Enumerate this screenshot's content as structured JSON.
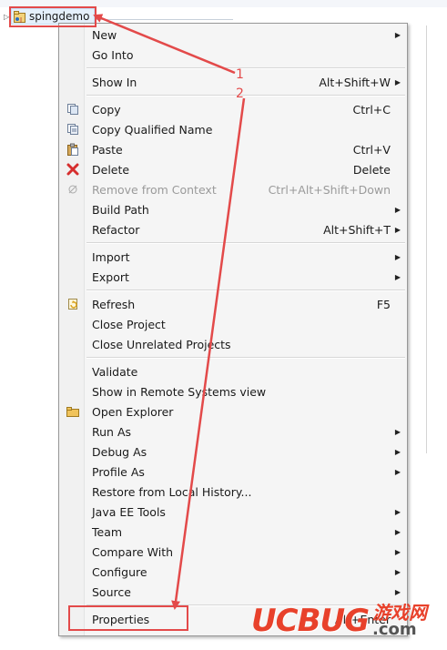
{
  "tree": {
    "project_name": "spingdemo"
  },
  "menu": {
    "groups": [
      [
        {
          "label": "New",
          "shortcut": "",
          "submenu": true,
          "disabled": false,
          "icon": ""
        },
        {
          "label": "Go Into",
          "shortcut": "",
          "submenu": false,
          "disabled": false,
          "icon": ""
        }
      ],
      [
        {
          "label": "Show In",
          "shortcut": "Alt+Shift+W",
          "submenu": true,
          "disabled": false,
          "icon": ""
        }
      ],
      [
        {
          "label": "Copy",
          "shortcut": "Ctrl+C",
          "submenu": false,
          "disabled": false,
          "icon": "copy-icon"
        },
        {
          "label": "Copy Qualified Name",
          "shortcut": "",
          "submenu": false,
          "disabled": false,
          "icon": "copy-qualified-name-icon"
        },
        {
          "label": "Paste",
          "shortcut": "Ctrl+V",
          "submenu": false,
          "disabled": false,
          "icon": "paste-icon"
        },
        {
          "label": "Delete",
          "shortcut": "Delete",
          "submenu": false,
          "disabled": false,
          "icon": "delete-icon"
        },
        {
          "label": "Remove from Context",
          "shortcut": "Ctrl+Alt+Shift+Down",
          "submenu": false,
          "disabled": true,
          "icon": "remove-from-context-icon"
        },
        {
          "label": "Build Path",
          "shortcut": "",
          "submenu": true,
          "disabled": false,
          "icon": ""
        },
        {
          "label": "Refactor",
          "shortcut": "Alt+Shift+T",
          "submenu": true,
          "disabled": false,
          "icon": ""
        }
      ],
      [
        {
          "label": "Import",
          "shortcut": "",
          "submenu": true,
          "disabled": false,
          "icon": ""
        },
        {
          "label": "Export",
          "shortcut": "",
          "submenu": true,
          "disabled": false,
          "icon": ""
        }
      ],
      [
        {
          "label": "Refresh",
          "shortcut": "F5",
          "submenu": false,
          "disabled": false,
          "icon": "refresh-icon"
        },
        {
          "label": "Close Project",
          "shortcut": "",
          "submenu": false,
          "disabled": false,
          "icon": ""
        },
        {
          "label": "Close Unrelated Projects",
          "shortcut": "",
          "submenu": false,
          "disabled": false,
          "icon": ""
        }
      ],
      [
        {
          "label": "Validate",
          "shortcut": "",
          "submenu": false,
          "disabled": false,
          "icon": ""
        },
        {
          "label": "Show in Remote Systems view",
          "shortcut": "",
          "submenu": false,
          "disabled": false,
          "icon": ""
        },
        {
          "label": "Open Explorer",
          "shortcut": "",
          "submenu": false,
          "disabled": false,
          "icon": "folder-icon"
        },
        {
          "label": "Run As",
          "shortcut": "",
          "submenu": true,
          "disabled": false,
          "icon": ""
        },
        {
          "label": "Debug As",
          "shortcut": "",
          "submenu": true,
          "disabled": false,
          "icon": ""
        },
        {
          "label": "Profile As",
          "shortcut": "",
          "submenu": true,
          "disabled": false,
          "icon": ""
        },
        {
          "label": "Restore from Local History...",
          "shortcut": "",
          "submenu": false,
          "disabled": false,
          "icon": ""
        },
        {
          "label": "Java EE Tools",
          "shortcut": "",
          "submenu": true,
          "disabled": false,
          "icon": ""
        },
        {
          "label": "Team",
          "shortcut": "",
          "submenu": true,
          "disabled": false,
          "icon": ""
        },
        {
          "label": "Compare With",
          "shortcut": "",
          "submenu": true,
          "disabled": false,
          "icon": ""
        },
        {
          "label": "Configure",
          "shortcut": "",
          "submenu": true,
          "disabled": false,
          "icon": ""
        },
        {
          "label": "Source",
          "shortcut": "",
          "submenu": true,
          "disabled": false,
          "icon": ""
        }
      ],
      [
        {
          "label": "Properties",
          "shortcut": "Alt+Enter",
          "submenu": false,
          "disabled": false,
          "icon": ""
        }
      ]
    ]
  },
  "annotations": {
    "step1": "1",
    "step2": "2",
    "color": "#e34a4a"
  },
  "watermark": {
    "brand_part1": "UC",
    "brand_part2": "BUG",
    "cn_text": "游戏网",
    "domain": ".com",
    "brand_color": "#e8412b"
  }
}
